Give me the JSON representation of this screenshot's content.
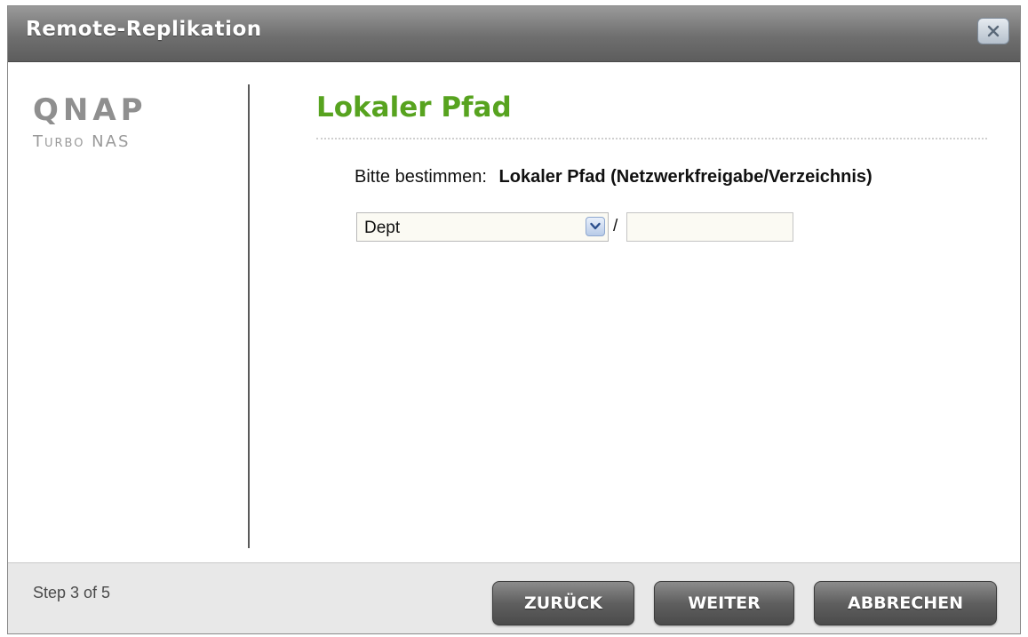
{
  "window": {
    "title": "Remote-Replikation"
  },
  "logo": {
    "brand": "QNAP",
    "product": "Turbo NAS"
  },
  "page": {
    "heading": "Lokaler Pfad",
    "prompt_label": "Bitte bestimmen:",
    "prompt_value": "Lokaler Pfad (Netzwerkfreigabe/Verzeichnis)"
  },
  "path": {
    "share_selected": "Dept",
    "separator": "/",
    "folder_value": ""
  },
  "footer": {
    "step": "Step 3 of 5",
    "back_label": "ZURÜCK",
    "next_label": "WEITER",
    "cancel_label": "ABBRECHEN"
  },
  "colors": {
    "heading": "#57a31f",
    "titlebar": "#6f6f6f",
    "button": "#5f5f5f"
  },
  "icons": {
    "close": "close-icon",
    "dropdown": "chevron-down-icon"
  }
}
